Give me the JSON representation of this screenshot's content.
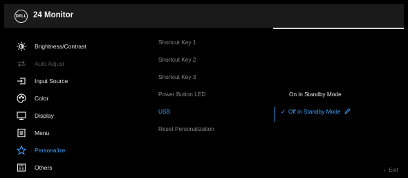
{
  "header": {
    "logo_text": "DELL",
    "title": "24 Monitor"
  },
  "menu": [
    {
      "label": "Brightness/Contrast",
      "icon": "brightness-icon",
      "state": "normal"
    },
    {
      "label": "Auto Adjust",
      "icon": "auto-adjust-icon",
      "state": "disabled"
    },
    {
      "label": "Input Source",
      "icon": "input-source-icon",
      "state": "normal"
    },
    {
      "label": "Color",
      "icon": "color-icon",
      "state": "normal"
    },
    {
      "label": "Display",
      "icon": "display-icon",
      "state": "normal"
    },
    {
      "label": "Menu",
      "icon": "menu-icon",
      "state": "normal"
    },
    {
      "label": "Personalize",
      "icon": "star-icon",
      "state": "active"
    },
    {
      "label": "Others",
      "icon": "others-icon",
      "state": "normal"
    }
  ],
  "submenu": [
    {
      "label": "Shortcut Key 1",
      "state": "normal"
    },
    {
      "label": "Shortcut Key 2",
      "state": "normal"
    },
    {
      "label": "Shortcut Key 3",
      "state": "normal"
    },
    {
      "label": "Power Button LED",
      "state": "normal"
    },
    {
      "label": "USB",
      "state": "active"
    },
    {
      "label": "Reset Personalization",
      "state": "normal"
    }
  ],
  "options": [
    {
      "label": "On in Standby Mode",
      "selected": false
    },
    {
      "label": "Off in Standby Mode",
      "selected": true
    }
  ],
  "footer": {
    "exit_label": "Exit"
  },
  "colors": {
    "accent": "#3ca1ff",
    "background": "#000000",
    "header": "#1a1a1a",
    "dim": "#5a5a5a"
  }
}
